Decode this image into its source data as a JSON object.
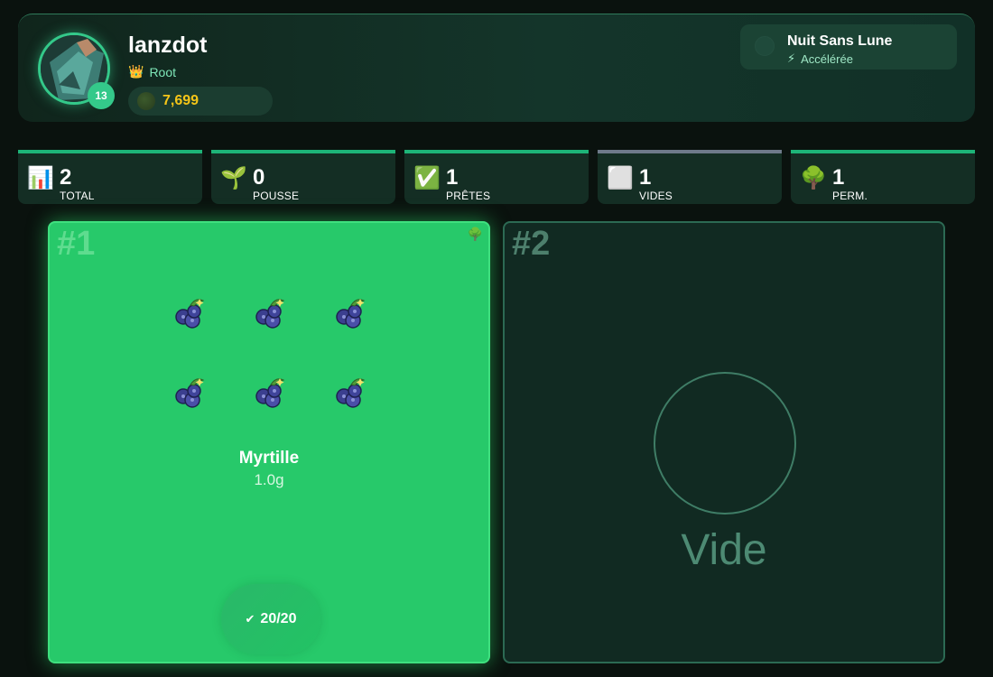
{
  "player": {
    "name": "lanzdot",
    "level": "13",
    "rank": "Root",
    "rank_icon": "crown-icon",
    "coins": "7,699"
  },
  "weather": {
    "title": "Nuit Sans Lune",
    "effect": "Accélérée",
    "effect_icon": "lightning-icon"
  },
  "stats": [
    {
      "icon": "📊",
      "icon_name": "chart-icon",
      "value": "2",
      "label": "TOTAL",
      "accent": "#1db478"
    },
    {
      "icon": "🌱",
      "icon_name": "sprout-icon",
      "value": "0",
      "label": "POUSSE",
      "accent": "#1db478"
    },
    {
      "icon": "✅",
      "icon_name": "check-icon",
      "value": "1",
      "label": "PRÊTES",
      "accent": "#1db478"
    },
    {
      "icon": "⬜",
      "icon_name": "empty-square-icon",
      "value": "1",
      "label": "VIDES",
      "accent": "#6e7a8a"
    },
    {
      "icon": "🌳",
      "icon_name": "tree-icon",
      "value": "1",
      "label": "PERM.",
      "accent": "#1db478"
    }
  ],
  "plots": [
    {
      "number": "#1",
      "state": "ready",
      "crop": "Myrtille",
      "weight": "1.0g",
      "fruit_count": 6,
      "harvest_label": "20/20",
      "permanent_icon": "tree-icon"
    },
    {
      "number": "#2",
      "state": "empty",
      "empty_label": "Vide"
    }
  ],
  "colors": {
    "ready_plot": "#27c96a",
    "empty_plot": "#112a22",
    "accent": "#34c98a",
    "coin": "#f5c518"
  }
}
